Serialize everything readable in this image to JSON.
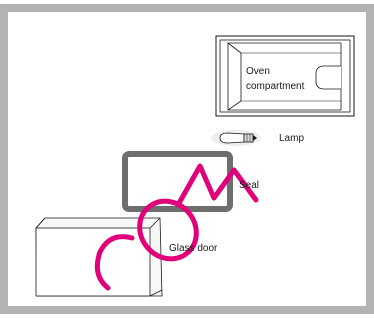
{
  "diagram": {
    "labels": {
      "oven_compartment_line1": "Oven",
      "oven_compartment_line2": "compartment",
      "lamp": "Lamp",
      "seal": "Seal",
      "glass_door": "Glass door"
    },
    "colors": {
      "frame": "#b3b3b3",
      "outline": "#1a1a1a",
      "seal": "#6e6e6e",
      "lamp": "#c8c8c8",
      "watermark": "#e0007a"
    },
    "watermark": {
      "text": "COM"
    }
  }
}
